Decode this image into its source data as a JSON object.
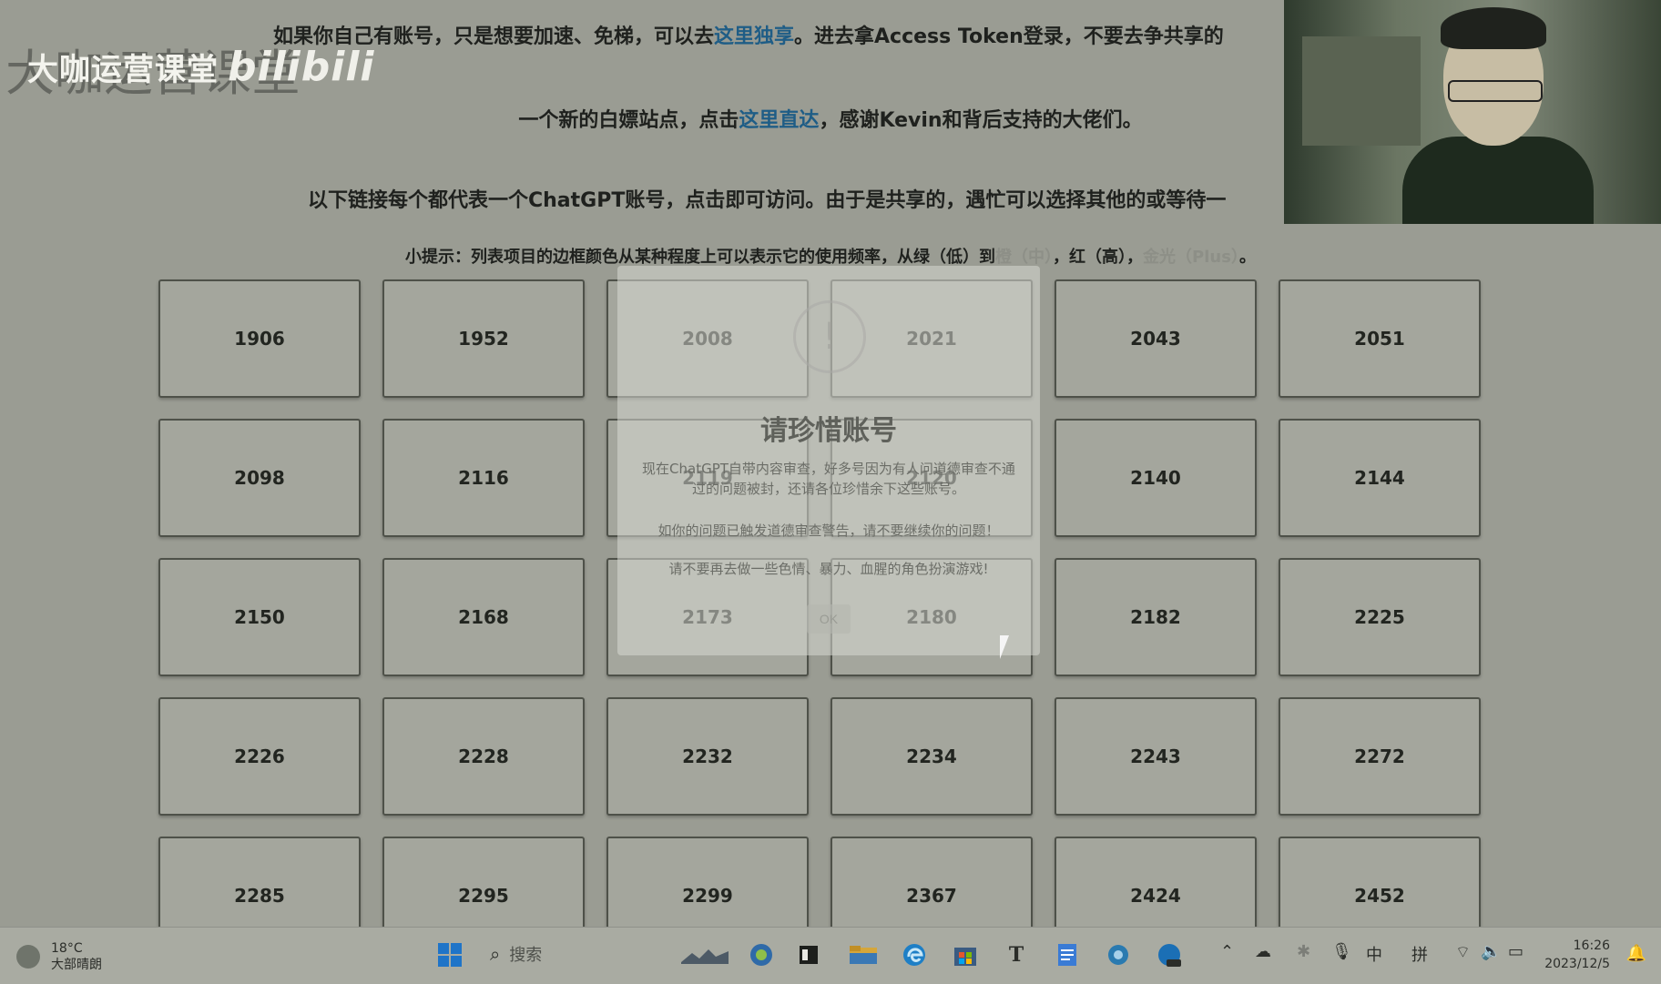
{
  "notice": {
    "line1_pre": "如果你自己有账号，只是想要加速、免梯，可以去",
    "line1_link": "这里独享",
    "line1_post": "。进去拿Access Token登录，不要去争共享的",
    "line2_pre": "一个新的白嫖站点，点击",
    "line2_link": "这里直达",
    "line2_post": "，感谢Kevin和背后支持的大佬们。",
    "line3": "以下链接每个都代表一个ChatGPT账号，点击即可访问。由于是共享的，遇忙可以选择其他的或等待一",
    "line4_pre": "小提示：列表项目的边框颜色从某种程度上可以表示它的使用频率，从绿（低）到",
    "line4_faint1": "橙（中）",
    "line4_mid": "，红（高），",
    "line4_faint2": "金光（Plus）",
    "line4_post": "。"
  },
  "watermark": {
    "text": "大咖运营课堂",
    "brand": "bilibili",
    "shadow": "大咖运营课堂"
  },
  "accounts": [
    "1906",
    "1952",
    "2008",
    "2021",
    "2043",
    "2051",
    "2098",
    "2116",
    "2119",
    "2120",
    "2140",
    "2144",
    "2150",
    "2168",
    "2173",
    "2180",
    "2182",
    "2225",
    "2226",
    "2228",
    "2232",
    "2234",
    "2243",
    "2272",
    "2285",
    "2295",
    "2299",
    "2367",
    "2424",
    "2452"
  ],
  "modal": {
    "icon": "!",
    "title": "请珍惜账号",
    "text1": "现在ChatGPT自带内容审查，好多号因为有人问道德审查不通过的问题被封，还请各位珍惜余下这些账号。",
    "text2": "如你的问题已触发道德审查警告，请不要继续你的问题！",
    "text3": "请不要再去做一些色情、暴力、血腥的角色扮演游戏!",
    "ok": "OK"
  },
  "taskbar": {
    "temp": "18°C",
    "weather": "大部晴朗",
    "search": "搜索",
    "ime1": "中",
    "ime2": "拼",
    "time": "16:26",
    "date": "2023/12/5"
  }
}
